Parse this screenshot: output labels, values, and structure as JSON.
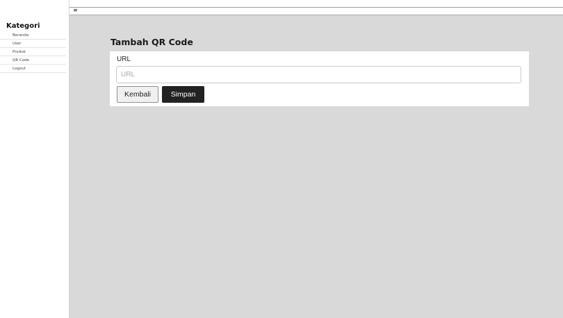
{
  "sidebar": {
    "title": "Kategori",
    "items": [
      {
        "label": "Beranda"
      },
      {
        "label": "User"
      },
      {
        "label": "Produk"
      },
      {
        "label": "QR Code"
      },
      {
        "label": "Logout"
      }
    ]
  },
  "topbar": {
    "menu_icon": "≡"
  },
  "main": {
    "title": "Tambah QR Code",
    "form": {
      "url_label": "URL",
      "url_placeholder": "URL",
      "url_value": ""
    },
    "buttons": {
      "back_label": "Kembali",
      "save_label": "Simpan"
    }
  },
  "colors": {
    "main_background": "#d9d9d9",
    "card_background": "#ffffff",
    "primary_button": "#222222",
    "secondary_button": "#f0f0f0"
  }
}
